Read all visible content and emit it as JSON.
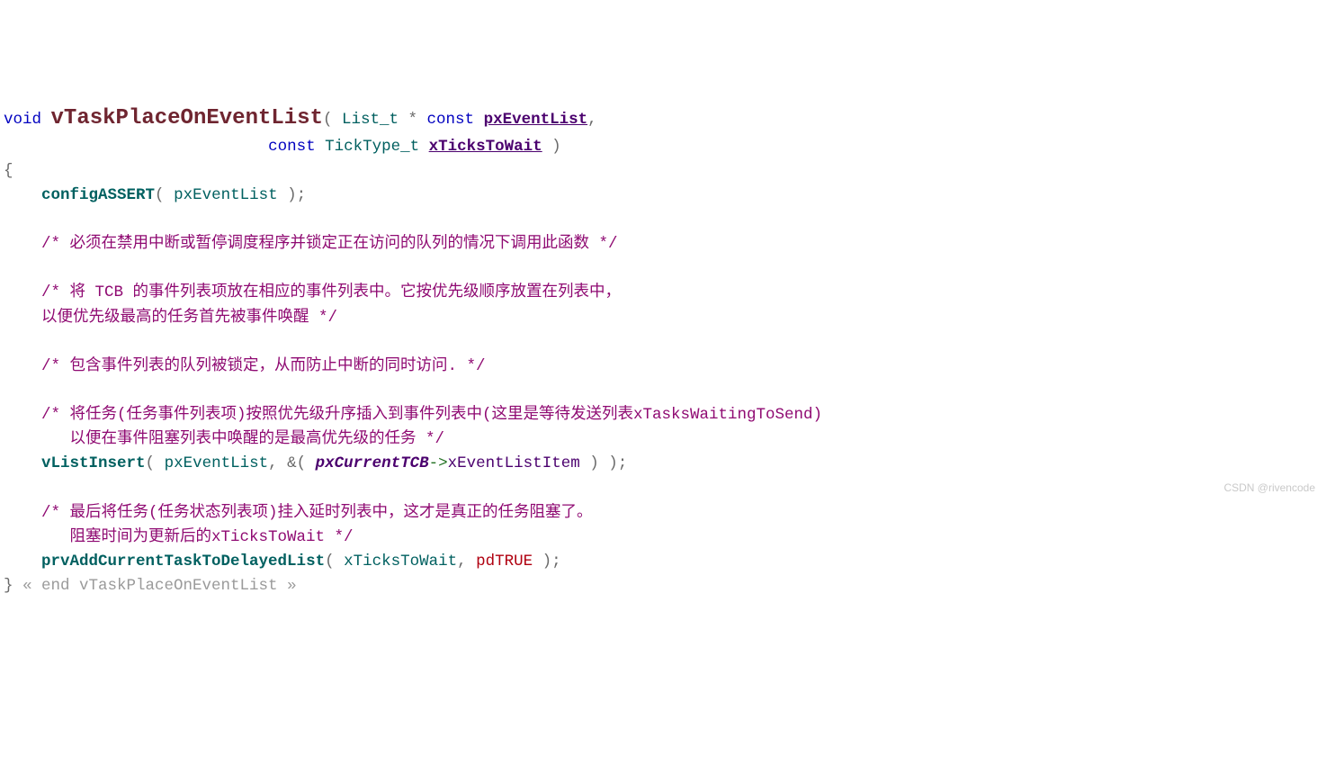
{
  "code": {
    "sig": {
      "void": "void",
      "fn": "vTaskPlaceOnEventList",
      "lp": "(",
      "p1_type": "List_t",
      "p1_star": " * ",
      "p1_const": "const",
      "p1_name": "pxEventList",
      "comma": ",",
      "p2_const": "const",
      "p2_type": "TickType_t",
      "p2_name": "xTicksToWait",
      "rp": " )"
    },
    "open_brace": "{",
    "assert": {
      "fn": "configASSERT",
      "lp": "( ",
      "arg": "pxEventList",
      "rp": " );"
    },
    "c1": "/* 必须在禁用中断或暂停调度程序并锁定正在访问的队列的情况下调用此函数 */",
    "c2a": "/* 将 TCB 的事件列表项放在相应的事件列表中。它按优先级顺序放置在列表中，",
    "c2b": "以便优先级最高的任务首先被事件唤醒 */",
    "c3": "/* 包含事件列表的队列被锁定，从而防止中断的同时访问. */",
    "c4a": "/* 将任务(任务事件列表项)按照优先级升序插入到事件列表中(这里是等待发送列表xTasksWaitingToSend)",
    "c4b": "   以便在事件阻塞列表中唤醒的是最高优先级的任务 */",
    "insert": {
      "fn": "vListInsert",
      "lp": "( ",
      "arg1": "pxEventList",
      "comma": ", ",
      "amp": "&( ",
      "tcb": "pxCurrentTCB",
      "arrow": "->",
      "member": "xEventListItem",
      "rp": " ) );"
    },
    "c5a": "/* 最后将任务(任务状态列表项)挂入延时列表中，这才是真正的任务阻塞了。",
    "c5b": "   阻塞时间为更新后的xTicksToWait */",
    "delay": {
      "fn": "prvAddCurrentTaskToDelayedList",
      "lp": "( ",
      "arg1": "xTicksToWait",
      "comma": ", ",
      "arg2": "pdTRUE",
      "rp": " );"
    },
    "close_brace": "}",
    "fold": " « end vTaskPlaceOnEventList »"
  },
  "watermark": "CSDN @rivencode"
}
